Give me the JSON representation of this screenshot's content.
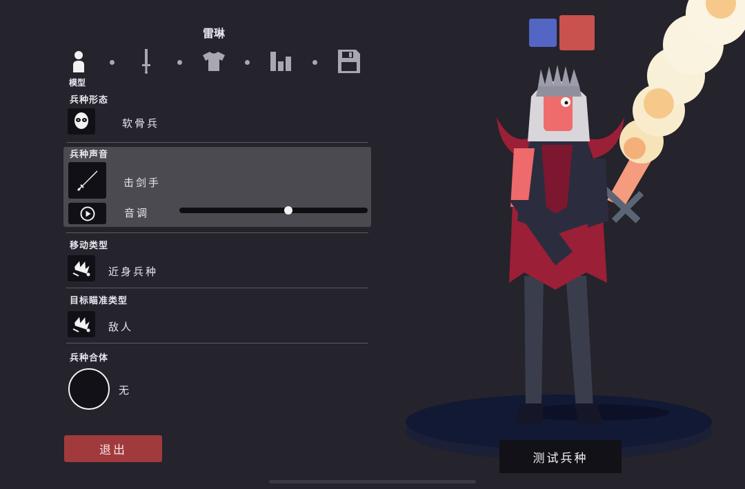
{
  "unit_name": "雷琳",
  "steps": [
    {
      "name": "model",
      "icon": "person-icon"
    },
    {
      "name": "weapon",
      "icon": "sword-icon"
    },
    {
      "name": "clothing",
      "icon": "shirt-icon"
    },
    {
      "name": "stats",
      "icon": "bar-chart-icon"
    },
    {
      "name": "save",
      "icon": "floppy-disk-icon"
    }
  ],
  "active_step_label": "模型",
  "sections": {
    "unit_form": {
      "label": "兵种形态",
      "value": "软骨兵",
      "icon": "skull-mask-icon"
    },
    "unit_voice": {
      "label": "兵种声音",
      "value": "击剑手",
      "icon": "rapier-icon",
      "pitch_label": "音调",
      "pitch_level": 0.58,
      "play_icon": "play-circle-icon"
    },
    "movement": {
      "label": "移动类型",
      "value": "近身兵种",
      "icon": "melee-crown-icon"
    },
    "targeting": {
      "label": "目标瞄准类型",
      "value": "敌人",
      "icon": "target-crown-icon"
    },
    "merge": {
      "label": "兵种合体",
      "value": "无"
    }
  },
  "buttons": {
    "exit": "退出",
    "test_unit": "测试兵种"
  },
  "team_colors": {
    "blue": "#5466c4",
    "red": "#c9524f"
  }
}
